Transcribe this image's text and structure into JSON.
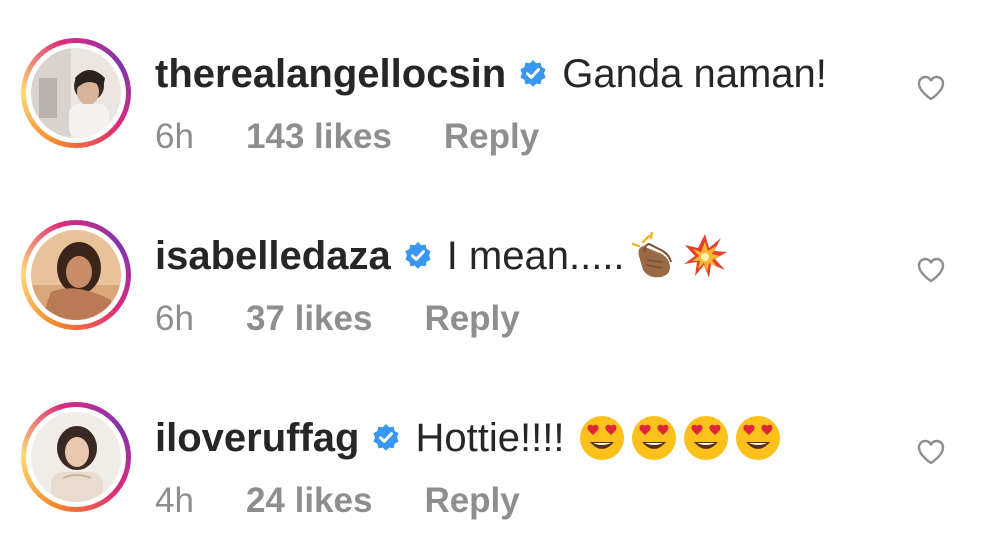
{
  "comments": [
    {
      "username": "therealangellocsin",
      "text": "Ganda naman!",
      "emojis": [],
      "time": "6h",
      "likes": "143 likes",
      "reply": "Reply",
      "verified": true
    },
    {
      "username": "isabelledaza",
      "text": "I mean.....",
      "emojis": [
        "clapping-hands-icon",
        "collision-icon"
      ],
      "time": "6h",
      "likes": "37 likes",
      "reply": "Reply",
      "verified": true
    },
    {
      "username": "iloveruffag",
      "text": "Hottie!!!!",
      "emojis": [
        "heart-eyes-face-icon",
        "heart-eyes-face-icon",
        "heart-eyes-face-icon",
        "heart-eyes-face-icon"
      ],
      "time": "4h",
      "likes": "24 likes",
      "reply": "Reply",
      "verified": true
    }
  ],
  "colors": {
    "text": "#262626",
    "meta": "#8e8e8e",
    "verified_badge": "#3897f0",
    "story_ring": [
      "#f58529",
      "#feda77",
      "#dd2a7b",
      "#8134af"
    ]
  }
}
